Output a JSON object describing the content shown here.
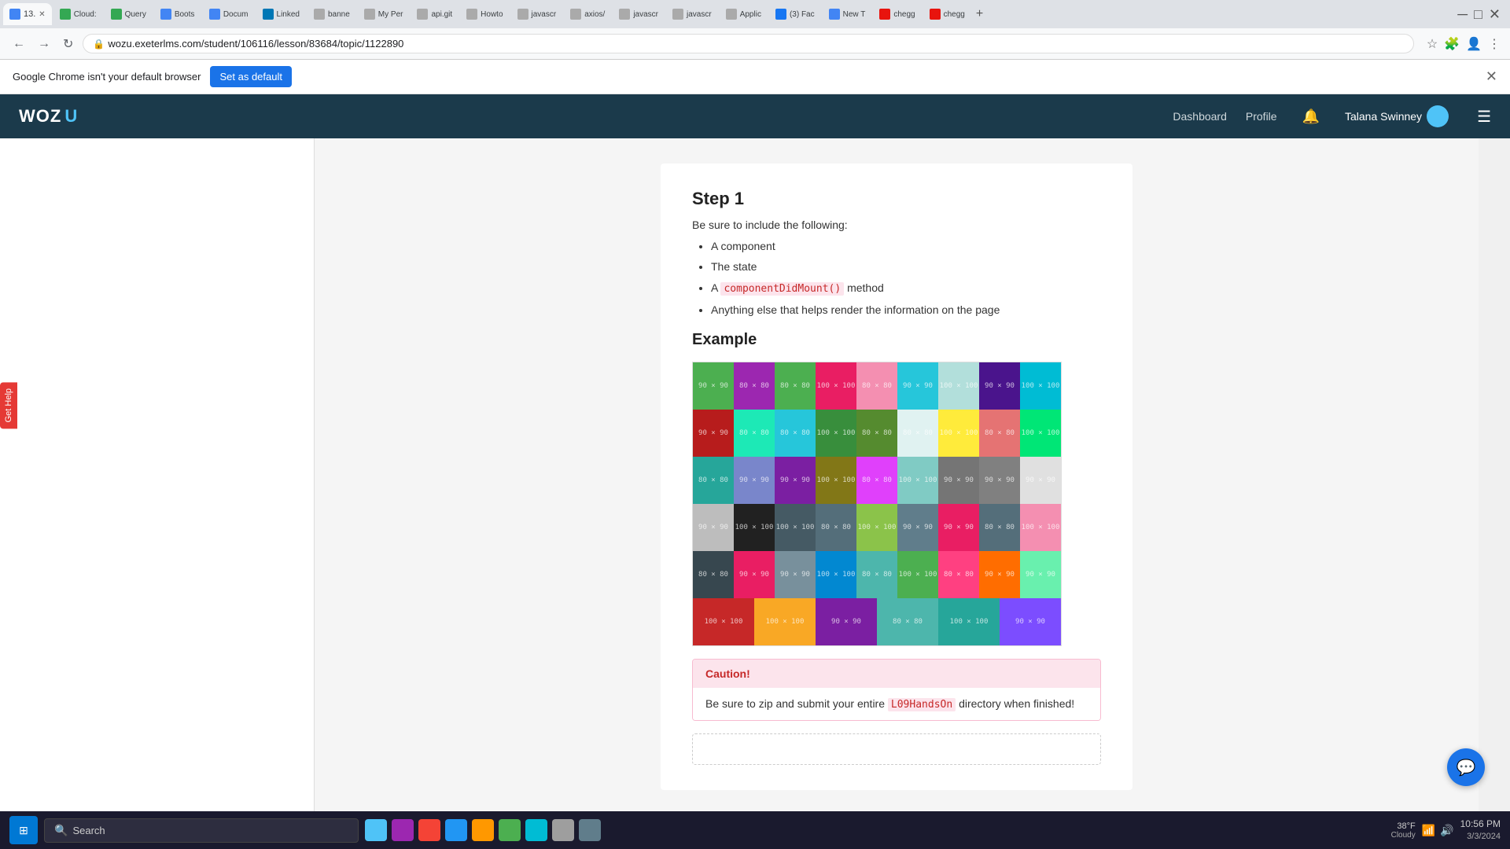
{
  "browser": {
    "url": "wozu.exeterlms.com/student/106116/lesson/83684/topic/1122890",
    "tabs": [
      {
        "label": "13.",
        "active": true,
        "favicon_color": "#4285f4"
      },
      {
        "label": "Cloud:",
        "active": false,
        "favicon_color": "#34a853"
      },
      {
        "label": "Query",
        "active": false,
        "favicon_color": "#34a853"
      },
      {
        "label": "Boots",
        "active": false,
        "favicon_color": "#4285f4"
      },
      {
        "label": "Docum",
        "active": false,
        "favicon_color": "#4285f4"
      },
      {
        "label": "Linked",
        "active": false,
        "favicon_color": "#0077b5"
      },
      {
        "label": "banne",
        "active": false,
        "favicon_color": "#aaa"
      },
      {
        "label": "My Per",
        "active": false,
        "favicon_color": "#aaa"
      },
      {
        "label": "api.git",
        "active": false,
        "favicon_color": "#aaa"
      },
      {
        "label": "Howto",
        "active": false,
        "favicon_color": "#aaa"
      },
      {
        "label": "javascr",
        "active": false,
        "favicon_color": "#aaa"
      },
      {
        "label": "axios/",
        "active": false,
        "favicon_color": "#aaa"
      },
      {
        "label": "javascr",
        "active": false,
        "favicon_color": "#aaa"
      },
      {
        "label": "javascr",
        "active": false,
        "favicon_color": "#aaa"
      },
      {
        "label": "Applic",
        "active": false,
        "favicon_color": "#aaa"
      },
      {
        "label": "(3) Fac",
        "active": false,
        "favicon_color": "#1877f2"
      },
      {
        "label": "New T",
        "active": false,
        "favicon_color": "#4285f4"
      },
      {
        "label": "chegg",
        "active": false,
        "favicon_color": "#e8140e"
      },
      {
        "label": "chegg",
        "active": false,
        "favicon_color": "#e8140e"
      }
    ],
    "default_banner": {
      "text": "Google Chrome isn't your default browser",
      "button_label": "Set as default"
    }
  },
  "app_nav": {
    "logo": "WOZ",
    "logo_bracket": "U",
    "links": [
      "Dashboard",
      "Profile"
    ],
    "user_name": "Talana Swinney"
  },
  "content": {
    "step_title": "Step 1",
    "step_intro": "Be sure to include the following:",
    "list_items": [
      "A component",
      "The state",
      "A componentDidMount() method",
      "Anything else that helps render the information on the page"
    ],
    "code_snippet": "componentDidMount()",
    "example_title": "Example",
    "caution": {
      "header": "Caution!",
      "body_text": "Be sure to zip and submit your entire",
      "code": "L09HandsOn",
      "body_suffix": " directory when finished!"
    }
  },
  "get_help": {
    "label": "Get Help"
  },
  "chat_button": {
    "icon": "💬"
  },
  "taskbar": {
    "search_placeholder": "Search",
    "time": "10:56 PM",
    "date": "3/3/2024",
    "weather_temp": "38°F",
    "weather_condition": "Cloudy"
  },
  "color_grid": {
    "colors": [
      "#4caf50",
      "#9c27b0",
      "#4caf50",
      "#e91e63",
      "#f48fb1",
      "#26c6da",
      "#b2dfdb",
      "#4a148c",
      "#00bcd4",
      "#b71c1c",
      "#1de9b6",
      "#26c6da",
      "#388e3c",
      "#558b2f",
      "#e0f2f1",
      "#ffeb3b",
      "#e57373",
      "#00e676",
      "#26a69a",
      "#7986cb",
      "#7b1fa2",
      "#827717",
      "#e040fb",
      "#80cbc4",
      "#757575",
      "#808080",
      "#e0e0e0",
      "#bdbdbd",
      "#212121",
      "#455a64",
      "#546e7a",
      "#8bc34a",
      "#607d8b",
      "#e91e63",
      "#546e7a",
      "#f48fb1",
      "#37474f",
      "#e91e63",
      "#78909c",
      "#0288d1",
      "#4db6ac",
      "#4caf50",
      "#ff4081",
      "#ff6d00",
      "#69f0ae",
      "#c62828",
      "#f9a825",
      "#7b1fa2",
      "#4db6ac",
      "#26a69a",
      "#7c4dff"
    ]
  }
}
